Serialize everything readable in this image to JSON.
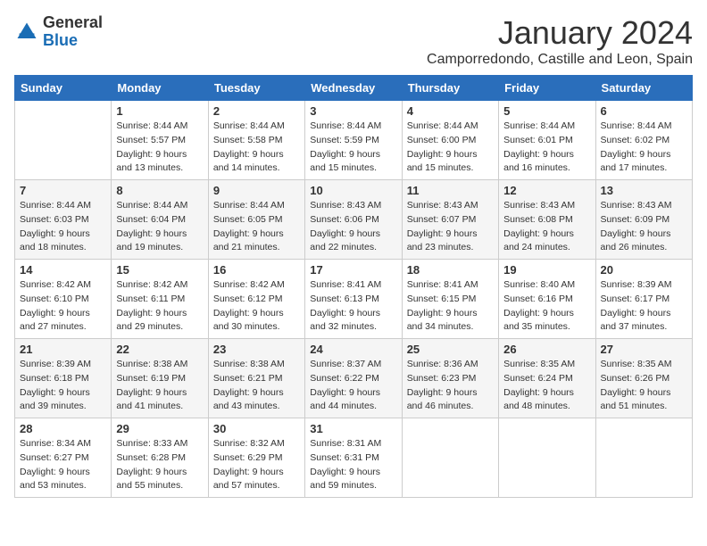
{
  "logo": {
    "general": "General",
    "blue": "Blue"
  },
  "title": "January 2024",
  "subtitle": "Camporredondo, Castille and Leon, Spain",
  "weekdays": [
    "Sunday",
    "Monday",
    "Tuesday",
    "Wednesday",
    "Thursday",
    "Friday",
    "Saturday"
  ],
  "weeks": [
    [
      {
        "day": "",
        "info": ""
      },
      {
        "day": "1",
        "info": "Sunrise: 8:44 AM\nSunset: 5:57 PM\nDaylight: 9 hours\nand 13 minutes."
      },
      {
        "day": "2",
        "info": "Sunrise: 8:44 AM\nSunset: 5:58 PM\nDaylight: 9 hours\nand 14 minutes."
      },
      {
        "day": "3",
        "info": "Sunrise: 8:44 AM\nSunset: 5:59 PM\nDaylight: 9 hours\nand 15 minutes."
      },
      {
        "day": "4",
        "info": "Sunrise: 8:44 AM\nSunset: 6:00 PM\nDaylight: 9 hours\nand 15 minutes."
      },
      {
        "day": "5",
        "info": "Sunrise: 8:44 AM\nSunset: 6:01 PM\nDaylight: 9 hours\nand 16 minutes."
      },
      {
        "day": "6",
        "info": "Sunrise: 8:44 AM\nSunset: 6:02 PM\nDaylight: 9 hours\nand 17 minutes."
      }
    ],
    [
      {
        "day": "7",
        "info": "Sunrise: 8:44 AM\nSunset: 6:03 PM\nDaylight: 9 hours\nand 18 minutes."
      },
      {
        "day": "8",
        "info": "Sunrise: 8:44 AM\nSunset: 6:04 PM\nDaylight: 9 hours\nand 19 minutes."
      },
      {
        "day": "9",
        "info": "Sunrise: 8:44 AM\nSunset: 6:05 PM\nDaylight: 9 hours\nand 21 minutes."
      },
      {
        "day": "10",
        "info": "Sunrise: 8:43 AM\nSunset: 6:06 PM\nDaylight: 9 hours\nand 22 minutes."
      },
      {
        "day": "11",
        "info": "Sunrise: 8:43 AM\nSunset: 6:07 PM\nDaylight: 9 hours\nand 23 minutes."
      },
      {
        "day": "12",
        "info": "Sunrise: 8:43 AM\nSunset: 6:08 PM\nDaylight: 9 hours\nand 24 minutes."
      },
      {
        "day": "13",
        "info": "Sunrise: 8:43 AM\nSunset: 6:09 PM\nDaylight: 9 hours\nand 26 minutes."
      }
    ],
    [
      {
        "day": "14",
        "info": "Sunrise: 8:42 AM\nSunset: 6:10 PM\nDaylight: 9 hours\nand 27 minutes."
      },
      {
        "day": "15",
        "info": "Sunrise: 8:42 AM\nSunset: 6:11 PM\nDaylight: 9 hours\nand 29 minutes."
      },
      {
        "day": "16",
        "info": "Sunrise: 8:42 AM\nSunset: 6:12 PM\nDaylight: 9 hours\nand 30 minutes."
      },
      {
        "day": "17",
        "info": "Sunrise: 8:41 AM\nSunset: 6:13 PM\nDaylight: 9 hours\nand 32 minutes."
      },
      {
        "day": "18",
        "info": "Sunrise: 8:41 AM\nSunset: 6:15 PM\nDaylight: 9 hours\nand 34 minutes."
      },
      {
        "day": "19",
        "info": "Sunrise: 8:40 AM\nSunset: 6:16 PM\nDaylight: 9 hours\nand 35 minutes."
      },
      {
        "day": "20",
        "info": "Sunrise: 8:39 AM\nSunset: 6:17 PM\nDaylight: 9 hours\nand 37 minutes."
      }
    ],
    [
      {
        "day": "21",
        "info": "Sunrise: 8:39 AM\nSunset: 6:18 PM\nDaylight: 9 hours\nand 39 minutes."
      },
      {
        "day": "22",
        "info": "Sunrise: 8:38 AM\nSunset: 6:19 PM\nDaylight: 9 hours\nand 41 minutes."
      },
      {
        "day": "23",
        "info": "Sunrise: 8:38 AM\nSunset: 6:21 PM\nDaylight: 9 hours\nand 43 minutes."
      },
      {
        "day": "24",
        "info": "Sunrise: 8:37 AM\nSunset: 6:22 PM\nDaylight: 9 hours\nand 44 minutes."
      },
      {
        "day": "25",
        "info": "Sunrise: 8:36 AM\nSunset: 6:23 PM\nDaylight: 9 hours\nand 46 minutes."
      },
      {
        "day": "26",
        "info": "Sunrise: 8:35 AM\nSunset: 6:24 PM\nDaylight: 9 hours\nand 48 minutes."
      },
      {
        "day": "27",
        "info": "Sunrise: 8:35 AM\nSunset: 6:26 PM\nDaylight: 9 hours\nand 51 minutes."
      }
    ],
    [
      {
        "day": "28",
        "info": "Sunrise: 8:34 AM\nSunset: 6:27 PM\nDaylight: 9 hours\nand 53 minutes."
      },
      {
        "day": "29",
        "info": "Sunrise: 8:33 AM\nSunset: 6:28 PM\nDaylight: 9 hours\nand 55 minutes."
      },
      {
        "day": "30",
        "info": "Sunrise: 8:32 AM\nSunset: 6:29 PM\nDaylight: 9 hours\nand 57 minutes."
      },
      {
        "day": "31",
        "info": "Sunrise: 8:31 AM\nSunset: 6:31 PM\nDaylight: 9 hours\nand 59 minutes."
      },
      {
        "day": "",
        "info": ""
      },
      {
        "day": "",
        "info": ""
      },
      {
        "day": "",
        "info": ""
      }
    ]
  ]
}
